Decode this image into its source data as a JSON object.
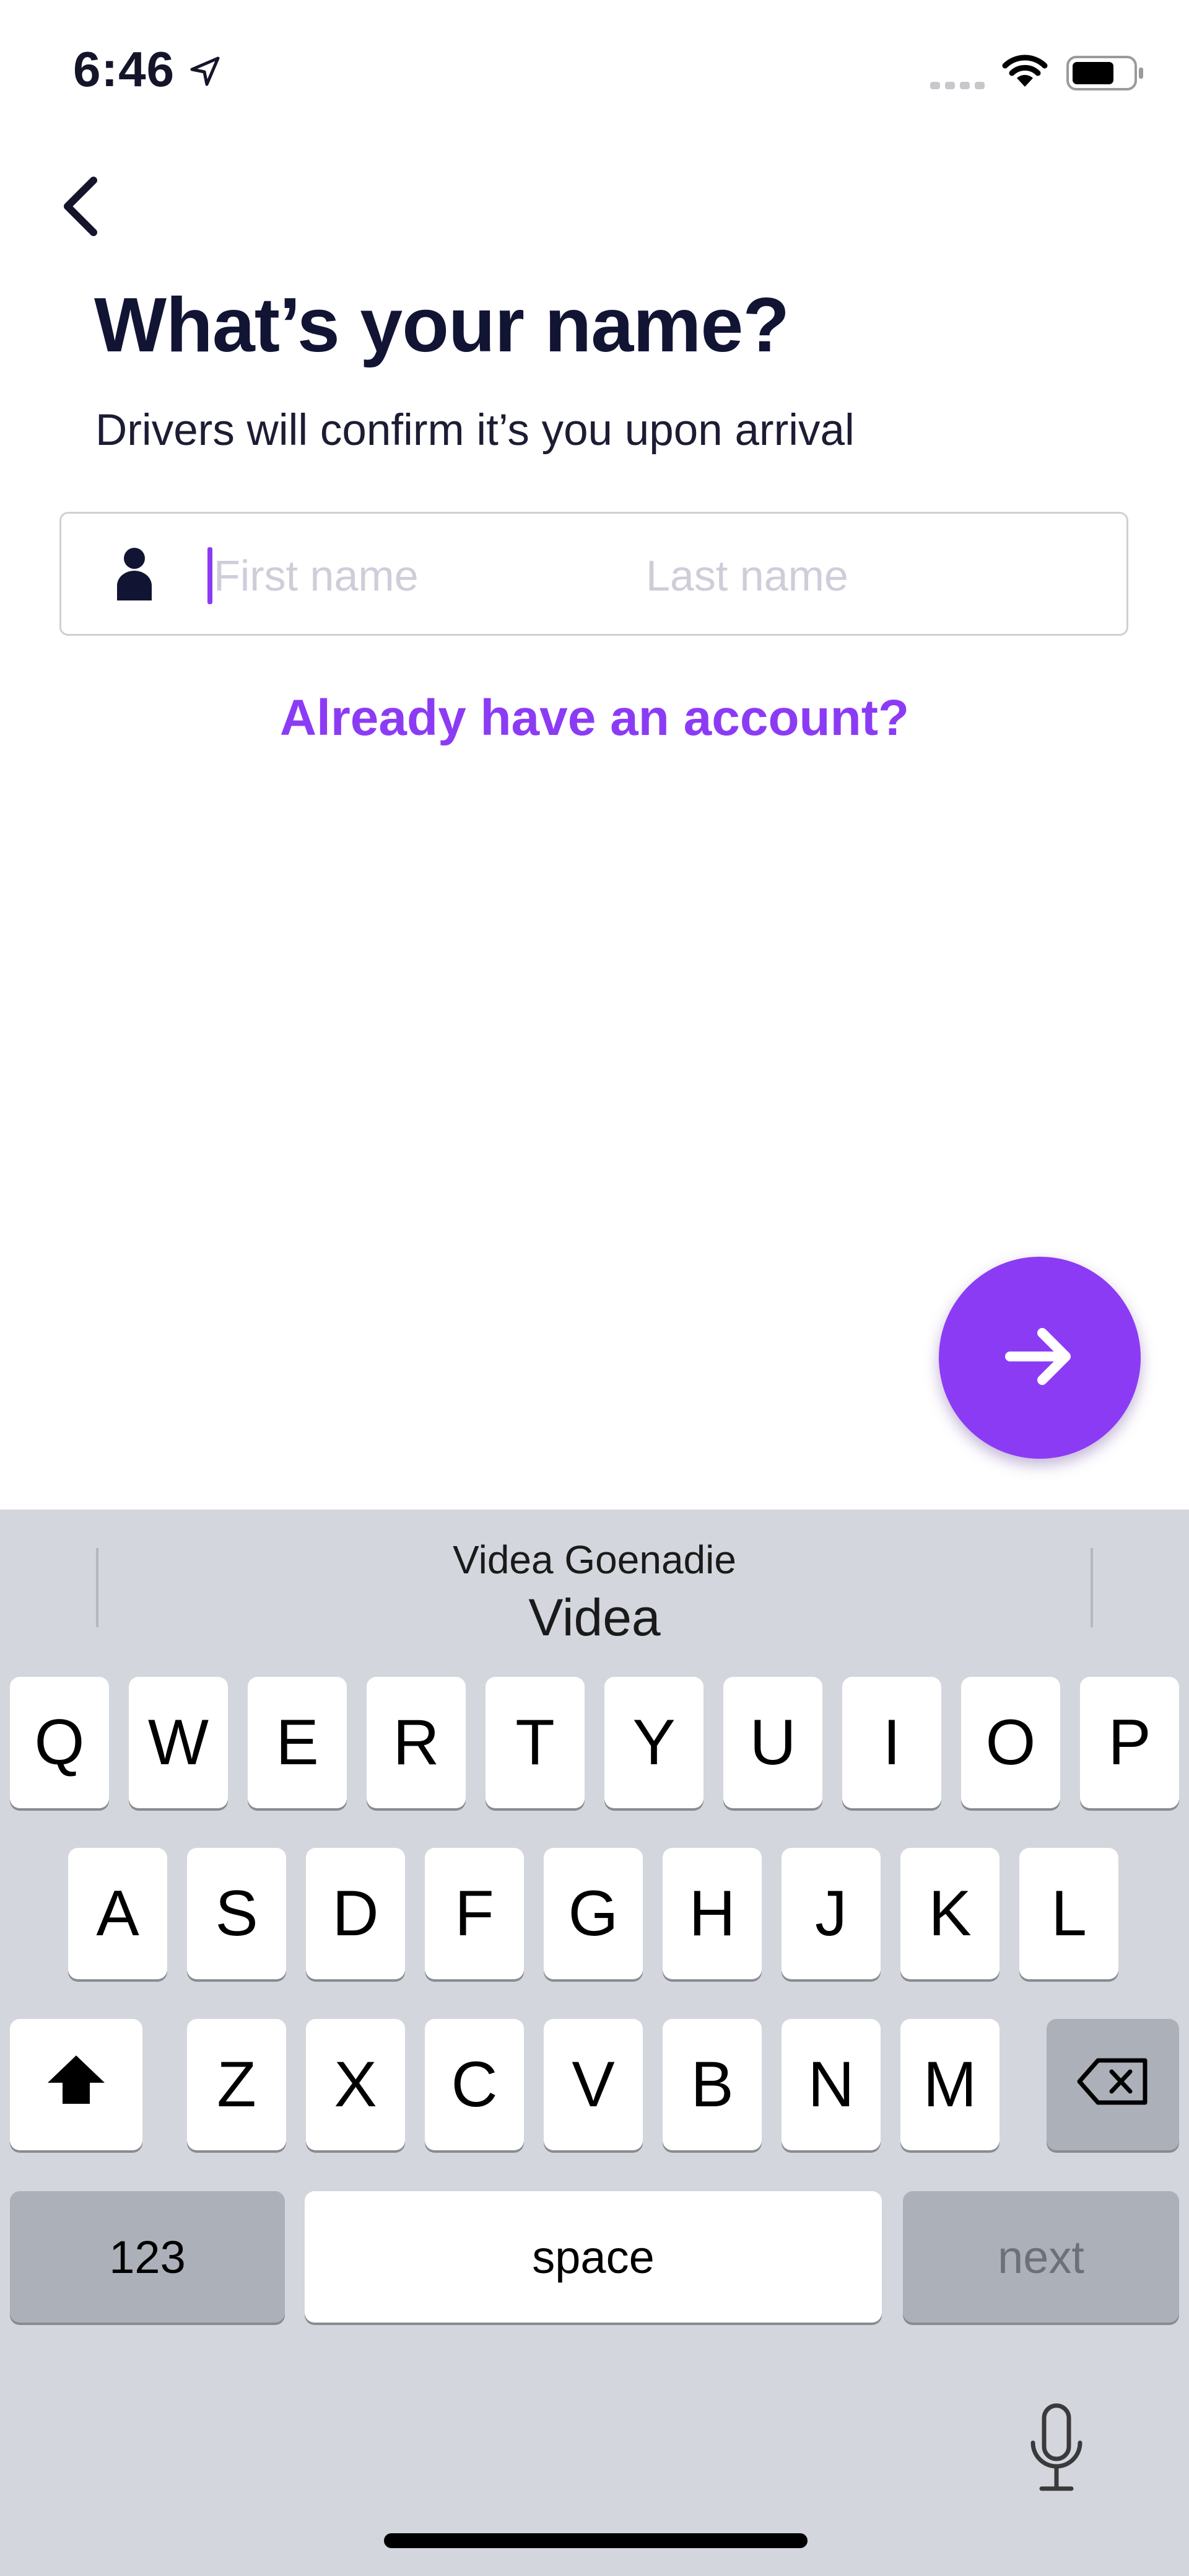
{
  "status_bar": {
    "time": "6:46",
    "icons": [
      "location-arrow-icon",
      "cellular-signal-icon",
      "wifi-icon",
      "battery-icon"
    ]
  },
  "header": {
    "back_icon": "chevron-left-icon",
    "title": "What’s your name?",
    "subtitle": "Drivers will confirm it’s you upon arrival"
  },
  "name_form": {
    "icon": "person-icon",
    "first_name": {
      "value": "",
      "placeholder": "First name"
    },
    "last_name": {
      "value": "",
      "placeholder": "Last name"
    }
  },
  "account_link": "Already have an account?",
  "next_button": {
    "icon": "arrow-right-icon"
  },
  "colors": {
    "accent": "#8C3BF5",
    "title": "#121434",
    "placeholder": "#D0CDDA",
    "keyboard_bg": "#D3D6DC"
  },
  "keyboard": {
    "suggestion": {
      "detail": "Videa Goenadie",
      "word": "Videa"
    },
    "row1": [
      "Q",
      "W",
      "E",
      "R",
      "T",
      "Y",
      "U",
      "I",
      "O",
      "P"
    ],
    "row2": [
      "A",
      "S",
      "D",
      "F",
      "G",
      "H",
      "J",
      "K",
      "L"
    ],
    "row3": [
      "Z",
      "X",
      "C",
      "V",
      "B",
      "N",
      "M"
    ],
    "numbers_key": "123",
    "space_key": "space",
    "return_key": "next",
    "shift_icon": "shift-icon",
    "delete_icon": "delete-icon",
    "mic_icon": "microphone-icon"
  }
}
